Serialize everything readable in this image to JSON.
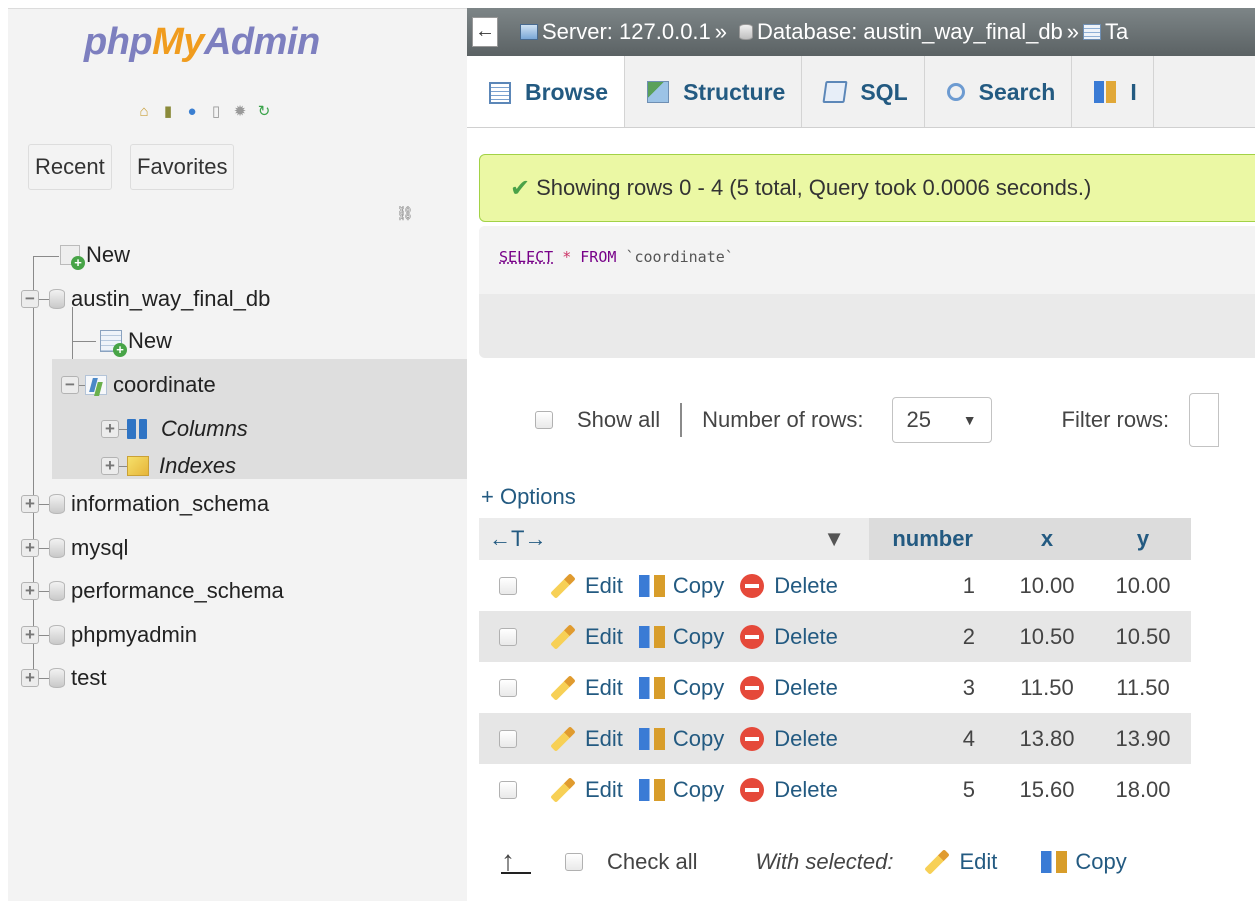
{
  "nav": {
    "logo": {
      "php": "php",
      "my": "My",
      "admin": "Admin"
    },
    "icons": [
      "home-icon",
      "exit-icon",
      "help-icon",
      "docs-icon",
      "settings-icon",
      "reload-icon"
    ],
    "tabs": {
      "recent": "Recent",
      "favorites": "Favorites"
    },
    "tree": {
      "new_root": "New",
      "databases": [
        {
          "name": "austin_way_final_db",
          "expanded": true
        },
        {
          "name": "information_schema",
          "expanded": false
        },
        {
          "name": "mysql",
          "expanded": false
        },
        {
          "name": "performance_schema",
          "expanded": false
        },
        {
          "name": "phpmyadmin",
          "expanded": false
        },
        {
          "name": "test",
          "expanded": false
        }
      ],
      "db_new": "New",
      "table": "coordinate",
      "columns": "Columns",
      "indexes": "Indexes"
    }
  },
  "breadcrumb": {
    "back": "←",
    "server": "Server: 127.0.0.1",
    "separator": "»",
    "database": "Database: austin_way_final_db",
    "table": "Ta"
  },
  "tabs": [
    {
      "label": "Browse",
      "icon": "browse-icon",
      "active": true
    },
    {
      "label": "Structure",
      "icon": "structure-icon"
    },
    {
      "label": "SQL",
      "icon": "sql-icon"
    },
    {
      "label": "Search",
      "icon": "search-icon"
    },
    {
      "label": "I",
      "icon": "insert-icon"
    }
  ],
  "message": {
    "success": "Showing rows 0 - 4 (5 total, Query took 0.0006 seconds.)",
    "sql": {
      "select": "SELECT",
      "star": "*",
      "from": "FROM",
      "table": "`coordinate`"
    }
  },
  "navigation": {
    "show_all": "Show all",
    "rows_label": "Number of rows:",
    "rows_value": "25",
    "filter_label": "Filter rows:"
  },
  "options_link": "+ Options",
  "table": {
    "arrows": "←T→",
    "sort_icon": "▼",
    "columns": [
      "number",
      "x",
      "y"
    ],
    "row_actions": {
      "edit": "Edit",
      "copy": "Copy",
      "delete": "Delete"
    },
    "rows": [
      {
        "number": "1",
        "x": "10.00",
        "y": "10.00"
      },
      {
        "number": "2",
        "x": "10.50",
        "y": "10.50"
      },
      {
        "number": "3",
        "x": "11.50",
        "y": "11.50"
      },
      {
        "number": "4",
        "x": "13.80",
        "y": "13.90"
      },
      {
        "number": "5",
        "x": "15.60",
        "y": "18.00"
      }
    ]
  },
  "bulk": {
    "check_all": "Check all",
    "with_selected": "With selected:",
    "edit": "Edit",
    "copy": "Copy"
  },
  "colors": {
    "link": "#235a81",
    "success_bg": "#ebf8a4",
    "success_border": "#a2d246",
    "topbar": "#6b7274"
  }
}
